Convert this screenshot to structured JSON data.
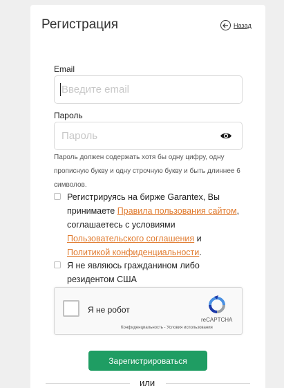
{
  "header": {
    "title": "Регистрация",
    "back_label": "Назад"
  },
  "email": {
    "label": "Email",
    "placeholder": "Введите email"
  },
  "password": {
    "label": "Пароль",
    "placeholder": "Пароль",
    "hint": "Пароль должен содержать хотя бы одну цифру, одну прописную букву и одну строчную букву и быть длиннее 6 символов."
  },
  "terms": {
    "text_1": "Регистрируясь на бирже Garantex, Вы принимаете ",
    "link_1": "Правила пользования сайтом",
    "text_2": ", соглашаетесь с условиями ",
    "link_2": "Пользовательского соглашения",
    "text_3": " и ",
    "link_3": "Политикой конфиденциальности",
    "text_4": "."
  },
  "us_resident": {
    "label": "Я не являюсь гражданином либо резидентом США"
  },
  "recaptcha": {
    "label": "Я не робот",
    "brand": "reCAPTCHA",
    "terms": "Конфиденциальность - Условия использования"
  },
  "submit_label": "Зарегистрироваться",
  "divider_label": "или"
}
